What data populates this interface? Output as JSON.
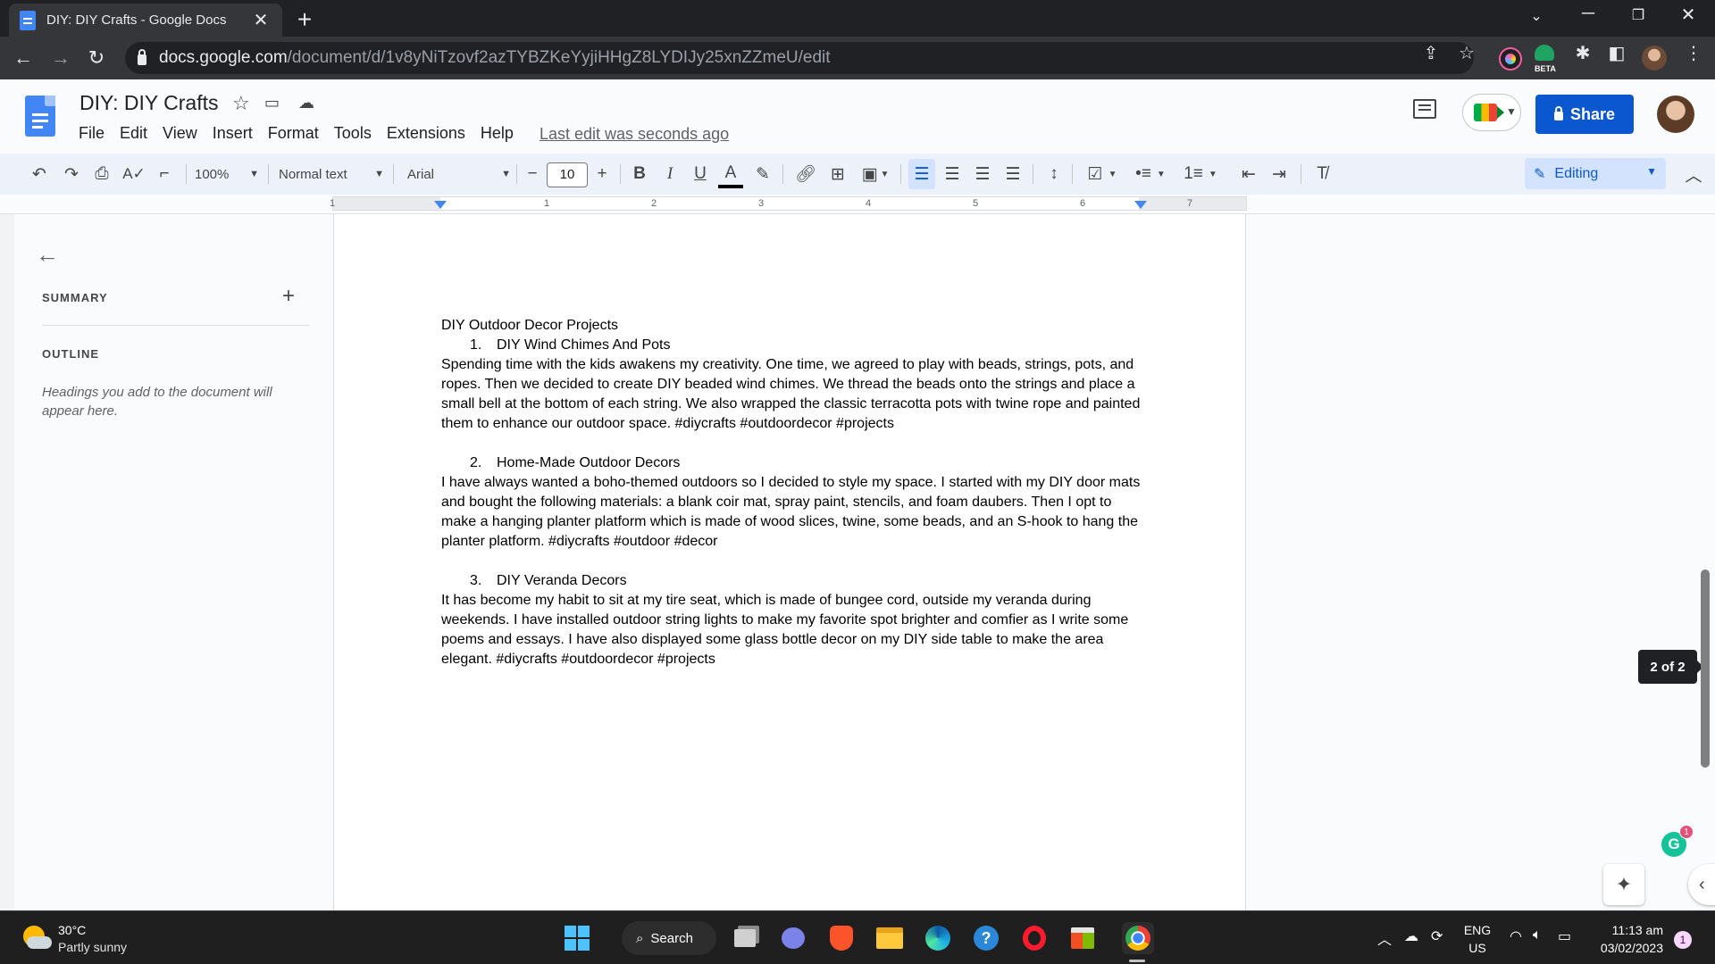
{
  "browser": {
    "tab_title": "DIY: DIY Crafts - Google Docs",
    "url_host": "docs.google.com",
    "url_path": "/document/d/1v8yNiTzovf2azTYBZKeYyjiHHgZ8LYDIJy25xnZZmeU/edit",
    "beta_badge": "BETA"
  },
  "docs": {
    "title": "DIY: DIY Crafts",
    "menu": [
      "File",
      "Edit",
      "View",
      "Insert",
      "Format",
      "Tools",
      "Extensions",
      "Help"
    ],
    "last_edit": "Last edit was seconds ago",
    "share_label": "Share"
  },
  "toolbar": {
    "zoom": "100%",
    "style": "Normal text",
    "font": "Arial",
    "font_size": "10",
    "mode": "Editing"
  },
  "ruler": {
    "numbers": [
      "1",
      "1",
      "2",
      "3",
      "4",
      "5",
      "6",
      "7"
    ]
  },
  "outline": {
    "summary_label": "SUMMARY",
    "outline_label": "OUTLINE",
    "hint": "Headings you add to the document will appear here."
  },
  "document": {
    "heading": "DIY Outdoor Decor Projects",
    "sections": [
      {
        "number": "1.",
        "title": "DIY Wind Chimes And Pots",
        "body": "Spending time with the kids awakens my creativity. One time, we agreed to play with beads, strings, pots, and ropes. Then we decided to create DIY beaded wind chimes. We thread the beads onto the strings and place a small bell at the bottom of each string. We also wrapped the classic terracotta pots with twine rope and painted them to enhance our outdoor space. #diycrafts #outdoordecor #projects"
      },
      {
        "number": "2.",
        "title": "Home-Made Outdoor Decors",
        "body": "I have always wanted a boho-themed outdoors so I decided to style my space. I started with my DIY door mats and bought the following materials: a blank coir mat, spray paint, stencils, and foam daubers. Then I opt to make a hanging planter platform which is made of wood slices, twine, some beads, and an S-hook to hang the planter platform. #diycrafts #outdoor #decor"
      },
      {
        "number": "3.",
        "title": "DIY Veranda Decors",
        "body": "It has become my habit to sit at my tire seat, which is made of bungee cord, outside my veranda during weekends. I have installed outdoor string lights to make my favorite spot brighter and comfier as I write some poems and essays. I have also displayed some glass bottle decor on my DIY side table to make the area elegant. #diycrafts #outdoordecor #projects"
      }
    ]
  },
  "page_counter": "2 of 2",
  "grammarly_count": "1",
  "taskbar": {
    "temperature": "30°C",
    "weather": "Partly sunny",
    "search_label": "Search",
    "lang_top": "ENG",
    "lang_bottom": "US",
    "time": "11:13 am",
    "date": "03/02/2023",
    "notifications": "1"
  },
  "colors": {
    "accent": "#0b57d0",
    "docs_blue": "#4285f4",
    "chrome_dark": "#202124"
  }
}
